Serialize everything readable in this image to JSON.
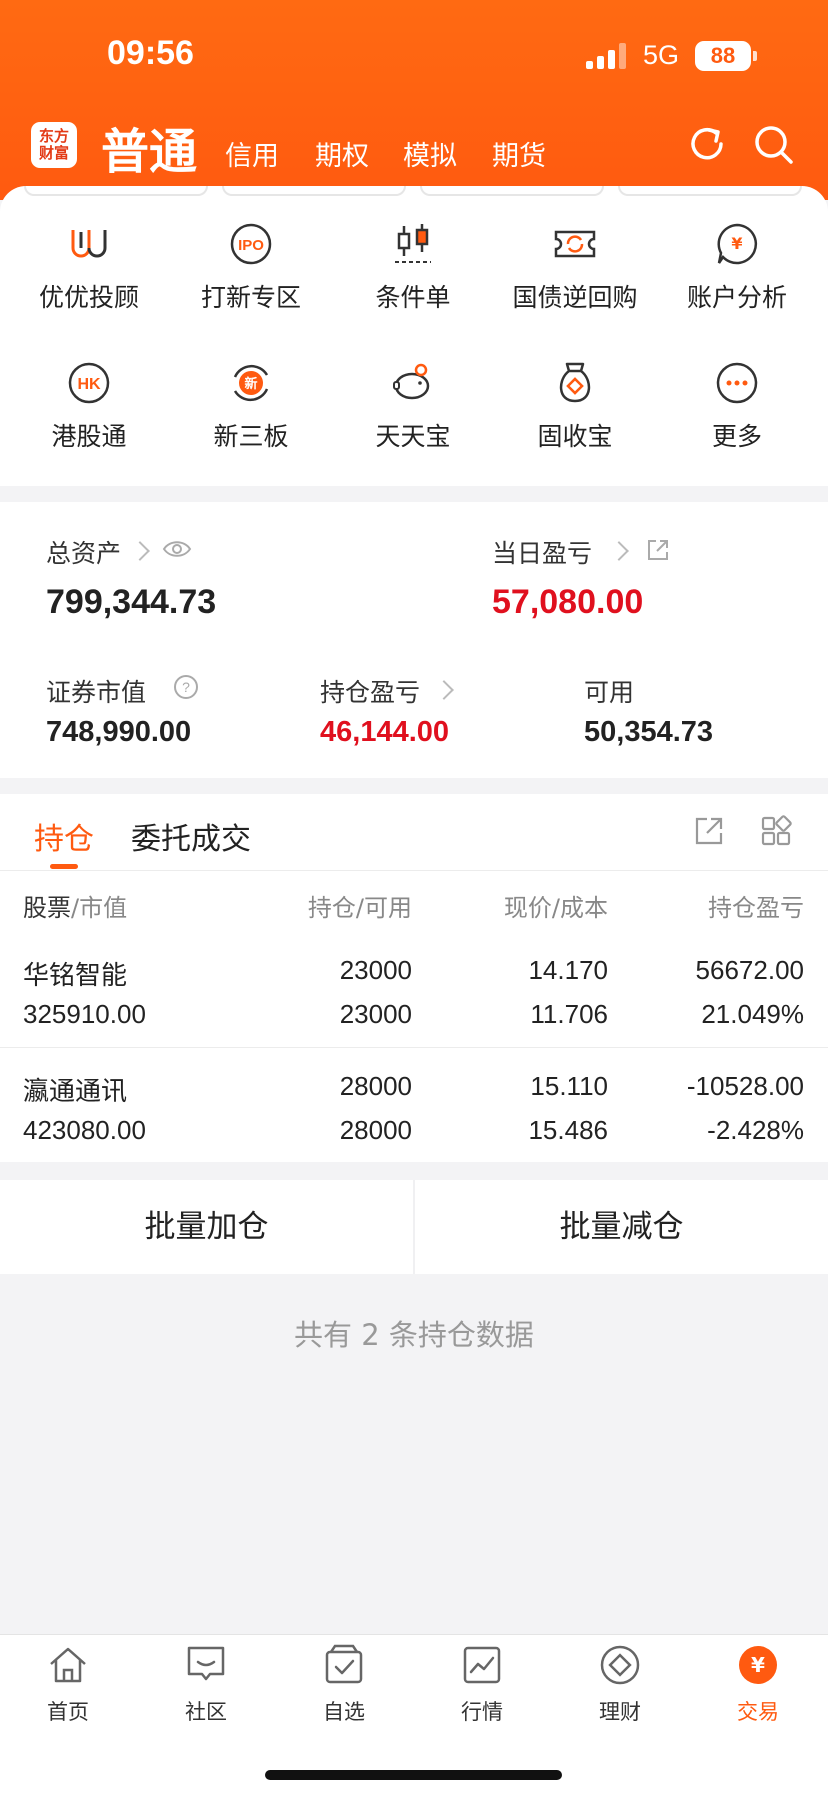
{
  "status": {
    "time": "09:56",
    "network": "5G",
    "battery": "88"
  },
  "header": {
    "logo_text": "东方财富",
    "active_mode": "普通",
    "mode_tabs": [
      "信用",
      "期权",
      "模拟",
      "期货"
    ],
    "icons": [
      "refresh-icon",
      "search-icon"
    ]
  },
  "shortcuts": [
    {
      "label": "优优投顾",
      "icon": "youyou-advisor-icon"
    },
    {
      "label": "打新专区",
      "icon": "ipo-icon"
    },
    {
      "label": "条件单",
      "icon": "candlestick-icon"
    },
    {
      "label": "国债逆回购",
      "icon": "bond-repo-icon"
    },
    {
      "label": "账户分析",
      "icon": "account-analysis-icon"
    },
    {
      "label": "港股通",
      "icon": "hk-icon"
    },
    {
      "label": "新三板",
      "icon": "new-third-board-icon"
    },
    {
      "label": "天天宝",
      "icon": "piggy-bank-icon"
    },
    {
      "label": "固收宝",
      "icon": "money-bag-icon"
    },
    {
      "label": "更多",
      "icon": "more-icon"
    }
  ],
  "assets": {
    "total_label": "总资产",
    "total_value": "799,344.73",
    "daily_pl_label": "当日盈亏",
    "daily_pl_value": "57,080.00",
    "market_value_label": "证券市值",
    "market_value": "748,990.00",
    "position_pl_label": "持仓盈亏",
    "position_pl_value": "46,144.00",
    "available_label": "可用",
    "available_value": "50,354.73"
  },
  "tabs": {
    "active": "持仓",
    "other": "委托成交"
  },
  "table": {
    "headers": {
      "c1_main": "股票",
      "c1_sub": "市值",
      "c2_main": "持仓",
      "c2_sub": "可用",
      "c3_main": "现价",
      "c3_sub": "成本",
      "c4_main": "持仓盈亏"
    },
    "rows": [
      {
        "name": "华铭智能",
        "market_value": "325910.00",
        "position": "23000",
        "available": "23000",
        "price": "14.170",
        "cost": "11.706",
        "pl": "56672.00",
        "pl_pct": "21.049%",
        "trend": "up"
      },
      {
        "name": "瀛通通讯",
        "market_value": "423080.00",
        "position": "28000",
        "available": "28000",
        "price": "15.110",
        "cost": "15.486",
        "pl": "-10528.00",
        "pl_pct": "-2.428%",
        "trend": "down"
      }
    ]
  },
  "actions": {
    "add": "批量加仓",
    "reduce": "批量减仓"
  },
  "summary": "共有 2 条持仓数据",
  "nav": [
    {
      "label": "首页",
      "icon": "home-icon"
    },
    {
      "label": "社区",
      "icon": "community-icon"
    },
    {
      "label": "自选",
      "icon": "watchlist-icon"
    },
    {
      "label": "行情",
      "icon": "market-chart-icon"
    },
    {
      "label": "理财",
      "icon": "wealth-icon"
    },
    {
      "label": "交易",
      "icon": "trade-icon",
      "active": true
    }
  ],
  "colors": {
    "brand": "#ff5a10",
    "up": "#e0101e",
    "down": "#3b9b2c"
  }
}
